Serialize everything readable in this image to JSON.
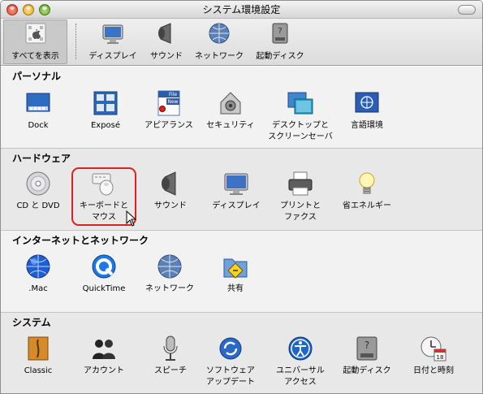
{
  "window": {
    "title": "システム環境設定"
  },
  "toolbar": {
    "show_all": "すべてを表示",
    "items": [
      "ディスプレイ",
      "サウンド",
      "ネットワーク",
      "起動ディスク"
    ]
  },
  "sections": {
    "personal": {
      "title": "パーソナル",
      "panes": [
        "Dock",
        "Exposé",
        "アピアランス",
        "セキュリティ",
        "デスクトップと\nスクリーンセーバ",
        "言語環境"
      ]
    },
    "hardware": {
      "title": "ハードウェア",
      "panes": [
        "CD と DVD",
        "キーボードと\nマウス",
        "サウンド",
        "ディスプレイ",
        "プリントと\nファクス",
        "省エネルギー"
      ]
    },
    "internet": {
      "title": "インターネットとネットワーク",
      "panes": [
        ".Mac",
        "QuickTime",
        "ネットワーク",
        "共有"
      ]
    },
    "system": {
      "title": "システム",
      "panes": [
        "Classic",
        "アカウント",
        "スピーチ",
        "ソフトウェア\nアップデート",
        "ユニバーサル\nアクセス",
        "起動ディスク",
        "日付と時刻"
      ]
    }
  },
  "icon_badges": {
    "appearance_file": "File",
    "appearance_new": "New",
    "calendar_day": "18"
  }
}
